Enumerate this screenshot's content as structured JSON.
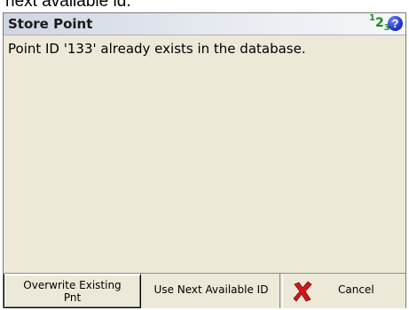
{
  "caption": "next available id.",
  "dialog": {
    "title": "Store Point",
    "indicator": {
      "sup": "1",
      "main": "2",
      "sub": "3"
    },
    "help_icon": "help-icon",
    "message": "Point ID '133' already exists in the database."
  },
  "buttons": {
    "overwrite_line1": "Overwrite Existing",
    "overwrite_line2": "Pnt",
    "next": "Use Next Available ID",
    "cancel": "Cancel",
    "cancel_icon": "red-x-icon"
  },
  "colors": {
    "background": "#ece9d8",
    "indicator": "#1e8a1e",
    "help_icon": "#2238c8",
    "cancel_icon": "#d01818"
  }
}
